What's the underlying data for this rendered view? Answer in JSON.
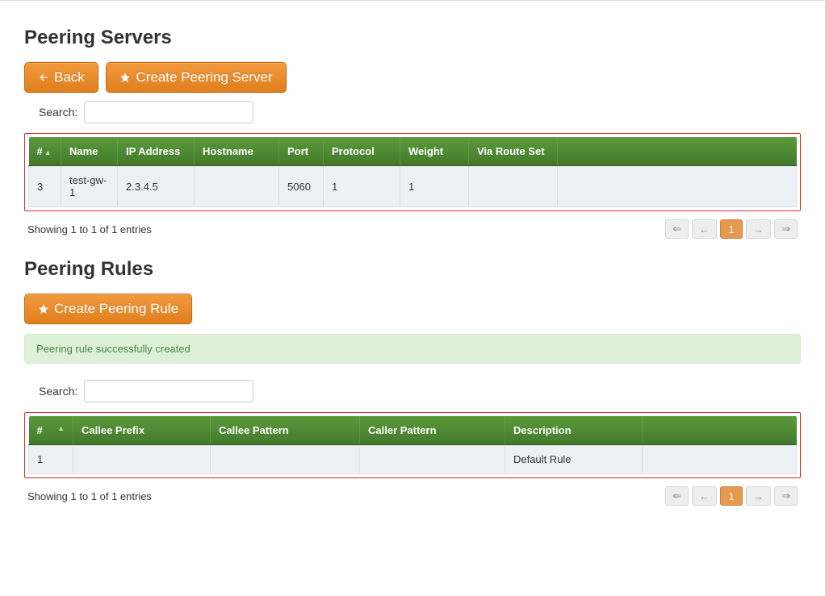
{
  "section_servers": {
    "title": "Peering Servers",
    "back_label": "Back",
    "create_label": "Create Peering Server",
    "search_label": "Search:",
    "headers": [
      "#",
      "Name",
      "IP Address",
      "Hostname",
      "Port",
      "Protocol",
      "Weight",
      "Via Route Set",
      ""
    ],
    "rows": [
      {
        "num": "3",
        "name": "test-gw-1",
        "ip": "2.3.4.5",
        "hostname": "",
        "port": "5060",
        "protocol": "1",
        "weight": "1",
        "via": "",
        "actions": ""
      }
    ],
    "entries_text": "Showing 1 to 1 of 1 entries",
    "page_current": "1"
  },
  "section_rules": {
    "title": "Peering Rules",
    "create_label": "Create Peering Rule",
    "success_msg": "Peering rule successfully created",
    "search_label": "Search:",
    "headers": [
      "#",
      "Callee Prefix",
      "Callee Pattern",
      "Caller Pattern",
      "Description",
      ""
    ],
    "rows": [
      {
        "num": "1",
        "callee_prefix": "",
        "callee_pattern": "",
        "caller_pattern": "",
        "description": "Default Rule",
        "actions": ""
      }
    ],
    "entries_text": "Showing 1 to 1 of 1 entries",
    "page_current": "1"
  },
  "pagination_labels": {
    "first": "⇐",
    "prev": "←",
    "next": "→",
    "last": "⇒"
  }
}
